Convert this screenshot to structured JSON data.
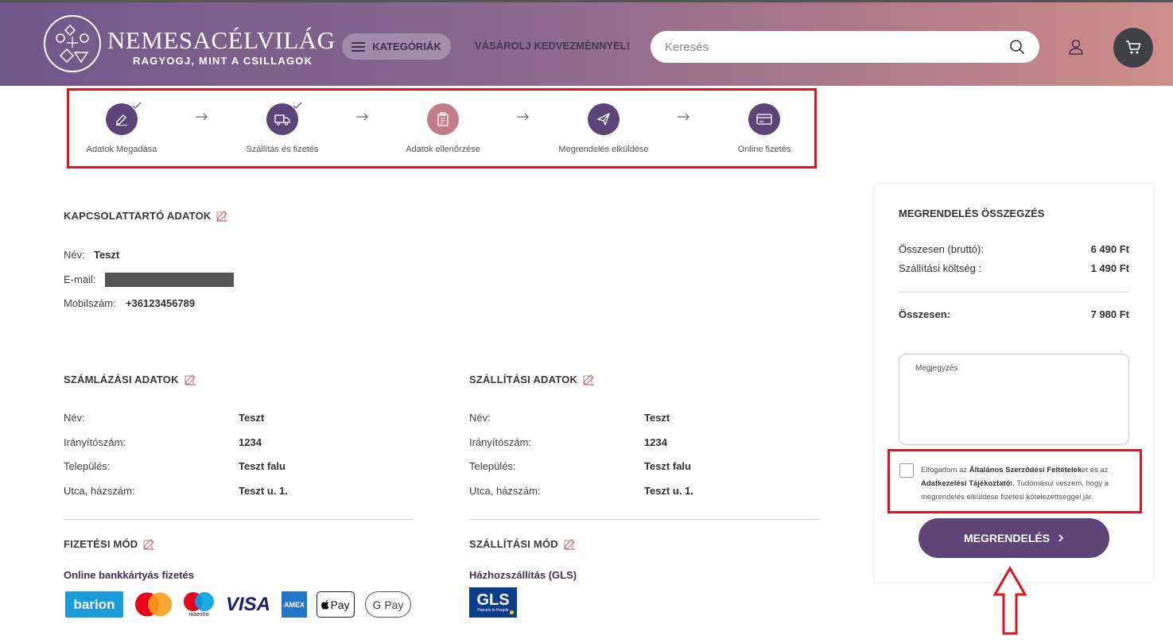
{
  "header": {
    "brand": "NEMESACÉLVILÁG",
    "tagline": "RAGYOGJ, MINT A CSILLAGOK",
    "categories_label": "KATEGÓRIÁK",
    "promo": "VÁSÁROLJ KEDVEZMÉNNYEL!",
    "search_placeholder": "Keresés"
  },
  "steps": [
    {
      "label": "Adatok Megadása",
      "status": "done",
      "icon": "edit-icon"
    },
    {
      "label": "Szállítás és fizetés",
      "status": "done",
      "icon": "truck-icon"
    },
    {
      "label": "Adatok ellenőrzése",
      "status": "current",
      "icon": "clipboard-icon"
    },
    {
      "label": "Megrendelés elküldése",
      "status": "upcoming",
      "icon": "send-icon"
    },
    {
      "label": "Online fizetés",
      "status": "upcoming",
      "icon": "card-icon"
    }
  ],
  "contact": {
    "title": "KAPCSOLATTARTÓ ADATOK",
    "name_label": "Név:",
    "name": "Teszt",
    "email_label": "E-mail:",
    "phone_label": "Mobilszám:",
    "phone": "+36123456789"
  },
  "billing": {
    "title": "SZÁMLÁZÁSI ADATOK",
    "rows": [
      {
        "label": "Név:",
        "value": "Teszt"
      },
      {
        "label": "Irányítószám:",
        "value": "1234"
      },
      {
        "label": "Település:",
        "value": "Teszt falu"
      },
      {
        "label": "Utca, házszám:",
        "value": "Teszt u. 1."
      }
    ]
  },
  "shipping": {
    "title": "SZÁLLÍTÁSI ADATOK",
    "rows": [
      {
        "label": "Név:",
        "value": "Teszt"
      },
      {
        "label": "Irányítószám:",
        "value": "1234"
      },
      {
        "label": "Település:",
        "value": "Teszt falu"
      },
      {
        "label": "Utca, házszám:",
        "value": "Teszt u. 1."
      }
    ]
  },
  "payment": {
    "title": "FIZETÉSI MÓD",
    "method": "Online bankkártyás fizetés",
    "logos": {
      "barion": "barion",
      "visa": "VISA",
      "amex": "AMEX",
      "apple_pay": "Pay",
      "google_pay": "G Pay",
      "maestro": "maestro"
    }
  },
  "delivery": {
    "title": "SZÁLLÍTÁSI MÓD",
    "method": "Házhozszállítás (GLS)",
    "gls": "GLS",
    "gls_sub": "Parcels to People"
  },
  "summary": {
    "title": "MEGRENDELÉS ÖSSZEGZÉS",
    "gross_label": "Összesen (bruttó):",
    "gross_value": "6 490 Ft",
    "shipping_label": "Szállítási költség :",
    "shipping_value": "1 490 Ft",
    "total_label": "Összesen:",
    "total_value": "7 980 Ft",
    "note_placeholder": "Megjegyzés",
    "terms_pre": "Elfogadom az ",
    "terms_link1": "Általános Szerződési Feltételek",
    "terms_mid": "et és az ",
    "terms_link2": "Adatkezelési Tájékoztató",
    "terms_post": "t. Tudomásul veszem, hogy a megrendelés elküldése fizetési kötelezettséggel jár.",
    "order_button": "MEGRENDELÉS"
  },
  "colors": {
    "accent": "#5b4579",
    "current_step": "#c07d87",
    "highlight": "#e0141e"
  }
}
